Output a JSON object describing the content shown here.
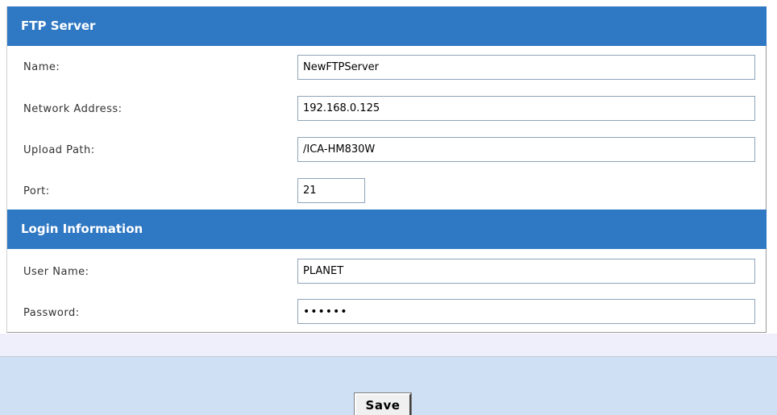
{
  "ftp_server": {
    "title": "FTP Server",
    "fields": [
      {
        "label": "Name:",
        "value": "NewFTPServer"
      },
      {
        "label": "Network Address:",
        "value": "192.168.0.125"
      },
      {
        "label": "Upload Path:",
        "value": "/ICA-HM830W"
      },
      {
        "label": "Port:",
        "value": "21"
      }
    ]
  },
  "login_information": {
    "title": "Login Information",
    "fields": [
      {
        "label": "User Name:",
        "value": "PLANET"
      },
      {
        "label": "Password:",
        "value": "••••••"
      }
    ]
  },
  "actions": {
    "save_label": "Save"
  },
  "colors": {
    "section_header": "#2f78c3",
    "footer": "#cfe0f4"
  }
}
